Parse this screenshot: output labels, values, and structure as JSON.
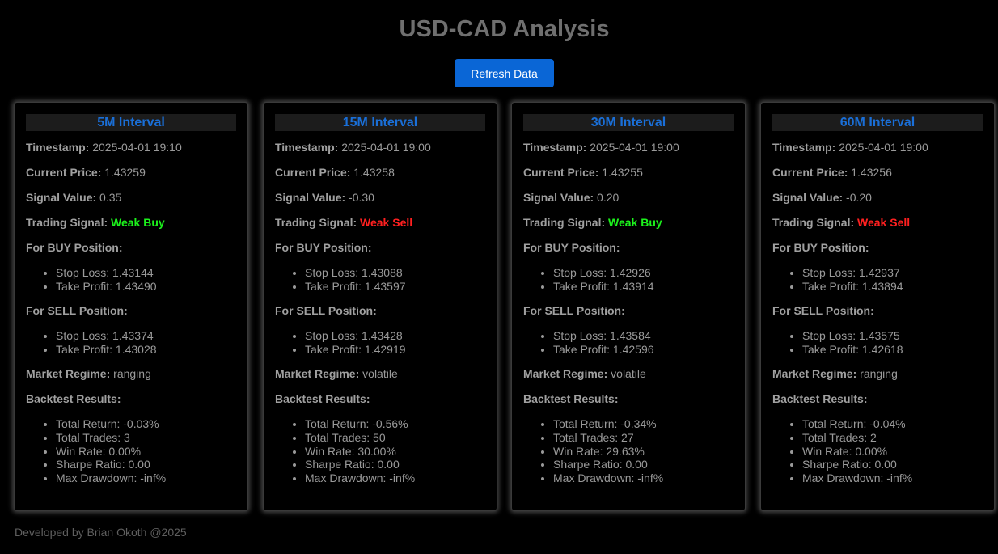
{
  "title": "USD-CAD Analysis",
  "refresh_label": "Refresh Data",
  "labels": {
    "timestamp": "Timestamp:",
    "current_price": "Current Price:",
    "signal_value": "Signal Value:",
    "trading_signal": "Trading Signal:",
    "buy_position": "For BUY Position:",
    "sell_position": "For SELL Position:",
    "market_regime": "Market Regime:",
    "backtest_results": "Backtest Results:"
  },
  "colors": {
    "buy_signal": "#1cf21c",
    "sell_signal": "#ff2020",
    "header_text": "#1a6fd8",
    "button": "#0a66d6"
  },
  "cards": [
    {
      "interval": "5M Interval",
      "timestamp": "2025-04-01 19:10",
      "current_price": "1.43259",
      "signal_value": "0.35",
      "trading_signal": "Weak Buy",
      "signal_type": "buy",
      "buy": {
        "stop_loss": "Stop Loss: 1.43144",
        "take_profit": "Take Profit: 1.43490"
      },
      "sell": {
        "stop_loss": "Stop Loss: 1.43374",
        "take_profit": "Take Profit: 1.43028"
      },
      "market_regime": "ranging",
      "backtest": {
        "total_return": "Total Return: -0.03%",
        "total_trades": "Total Trades: 3",
        "win_rate": "Win Rate: 0.00%",
        "sharpe": "Sharpe Ratio: 0.00",
        "max_drawdown": "Max Drawdown: -inf%"
      }
    },
    {
      "interval": "15M Interval",
      "timestamp": "2025-04-01 19:00",
      "current_price": "1.43258",
      "signal_value": "-0.30",
      "trading_signal": "Weak Sell",
      "signal_type": "sell",
      "buy": {
        "stop_loss": "Stop Loss: 1.43088",
        "take_profit": "Take Profit: 1.43597"
      },
      "sell": {
        "stop_loss": "Stop Loss: 1.43428",
        "take_profit": "Take Profit: 1.42919"
      },
      "market_regime": "volatile",
      "backtest": {
        "total_return": "Total Return: -0.56%",
        "total_trades": "Total Trades: 50",
        "win_rate": "Win Rate: 30.00%",
        "sharpe": "Sharpe Ratio: 0.00",
        "max_drawdown": "Max Drawdown: -inf%"
      }
    },
    {
      "interval": "30M Interval",
      "timestamp": "2025-04-01 19:00",
      "current_price": "1.43255",
      "signal_value": "0.20",
      "trading_signal": "Weak Buy",
      "signal_type": "buy",
      "buy": {
        "stop_loss": "Stop Loss: 1.42926",
        "take_profit": "Take Profit: 1.43914"
      },
      "sell": {
        "stop_loss": "Stop Loss: 1.43584",
        "take_profit": "Take Profit: 1.42596"
      },
      "market_regime": "volatile",
      "backtest": {
        "total_return": "Total Return: -0.34%",
        "total_trades": "Total Trades: 27",
        "win_rate": "Win Rate: 29.63%",
        "sharpe": "Sharpe Ratio: 0.00",
        "max_drawdown": "Max Drawdown: -inf%"
      }
    },
    {
      "interval": "60M Interval",
      "timestamp": "2025-04-01 19:00",
      "current_price": "1.43256",
      "signal_value": "-0.20",
      "trading_signal": "Weak Sell",
      "signal_type": "sell",
      "buy": {
        "stop_loss": "Stop Loss: 1.42937",
        "take_profit": "Take Profit: 1.43894"
      },
      "sell": {
        "stop_loss": "Stop Loss: 1.43575",
        "take_profit": "Take Profit: 1.42618"
      },
      "market_regime": "ranging",
      "backtest": {
        "total_return": "Total Return: -0.04%",
        "total_trades": "Total Trades: 2",
        "win_rate": "Win Rate: 0.00%",
        "sharpe": "Sharpe Ratio: 0.00",
        "max_drawdown": "Max Drawdown: -inf%"
      }
    }
  ],
  "footer": "Developed by Brian Okoth @2025"
}
